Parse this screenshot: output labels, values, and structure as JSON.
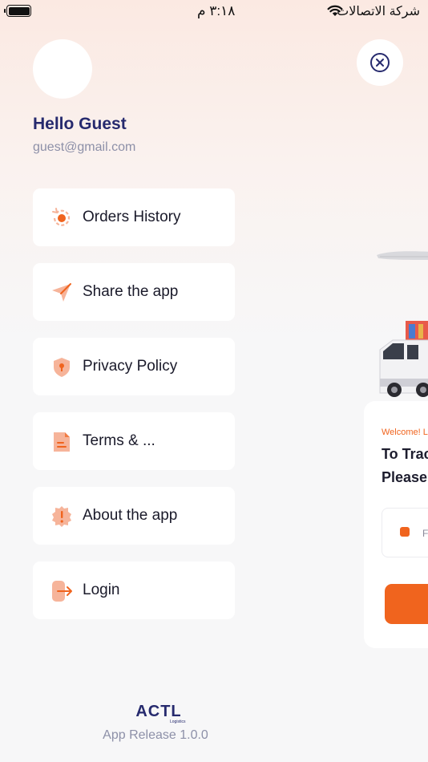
{
  "status_bar": {
    "carrier": "شركة الاتصالات",
    "time": "٣:١٨ م"
  },
  "user": {
    "greeting": "Hello Guest",
    "email": "guest@gmail.com"
  },
  "menu": {
    "items": [
      {
        "label": "Orders History",
        "icon": "orders-history-icon"
      },
      {
        "label": "Share the app",
        "icon": "share-icon"
      },
      {
        "label": "Privacy Policy",
        "icon": "privacy-shield-icon"
      },
      {
        "label": "Terms & ...",
        "icon": "terms-document-icon"
      },
      {
        "label": "About the app",
        "icon": "about-info-icon"
      },
      {
        "label": "Login",
        "icon": "login-icon"
      }
    ]
  },
  "background_screen": {
    "welcome": "Welcome! L",
    "track_line1": "To Trac",
    "track_line2": "Please",
    "input_placeholder": "F"
  },
  "footer": {
    "logo": "ACTL",
    "logo_sub": "Logistics",
    "release": "App Release 1.0.0"
  },
  "colors": {
    "accent": "#f0641e",
    "primary_text": "#262a6e",
    "muted": "#8d90a8",
    "icon_fill": "#f6b49a"
  }
}
